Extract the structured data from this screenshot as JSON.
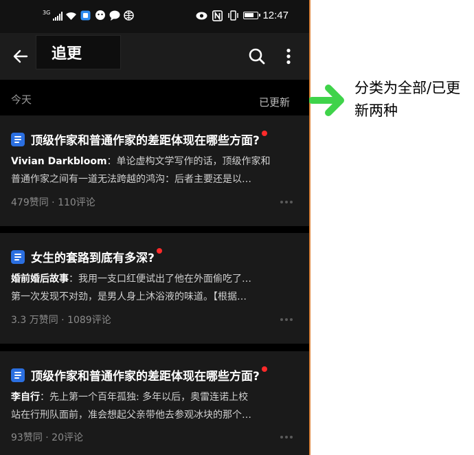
{
  "status_bar": {
    "network": "3G",
    "time": "12:47",
    "icons": [
      "signal-icon",
      "wifi-icon",
      "app-notification-icon",
      "wechat-icon",
      "message-icon",
      "browser-icon",
      "eye-icon",
      "nfc-icon",
      "vibrate-icon",
      "battery-icon"
    ]
  },
  "app_bar": {
    "title": "追更",
    "icons": [
      "back-arrow-icon",
      "search-icon",
      "more-vertical-icon"
    ]
  },
  "section": {
    "today_label": "今天",
    "filter_label": "已更新"
  },
  "cards": [
    {
      "title": "顶级作家和普通作家的差距体现在哪些方面?",
      "author": "Vivian Darkbloom",
      "excerpt_line1": "：单论虚构文学写作的话，顶级作家和",
      "excerpt_line2": "普通作家之间有一道无法跨越的鸿沟：后者主要还是以…",
      "meta": "479赞同 · 110评论"
    },
    {
      "title": "女生的套路到底有多深?",
      "author": "婚前婚后故事",
      "excerpt_line1": "：我用一支口红便试出了他在外面偷吃了…",
      "excerpt_line2": "第一次发现不对劲，是男人身上沐浴液的味道。【根据…",
      "meta": "3.3 万赞同 · 1089评论"
    },
    {
      "title": "顶级作家和普通作家的差距体现在哪些方面?",
      "author": "李自行",
      "excerpt_line1": "：先上第一个百年孤独: 多年以后，奥雷连诺上校",
      "excerpt_line2": "站在行刑队面前，准会想起父亲带他去参观冰块的那个…",
      "meta": "93赞同 · 20评论"
    }
  ],
  "annotation": {
    "text": "分类为全部/已更新两种",
    "arrow_color": "#3fd34a"
  },
  "colors": {
    "accent_blue": "#2b6fe0",
    "unread_dot": "#ff2a2a",
    "divider": "#d9823a"
  }
}
